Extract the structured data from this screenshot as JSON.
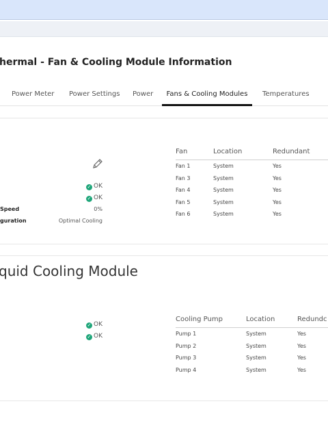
{
  "page_title": "hermal - Fan & Cooling Module Information",
  "tabs": [
    {
      "label": "Power Meter"
    },
    {
      "label": "Power Settings"
    },
    {
      "label": "Power"
    },
    {
      "label": "Fans & Cooling Modules",
      "active": true
    },
    {
      "label": "Temperatures"
    }
  ],
  "fans_summary": {
    "status1": "OK",
    "status2": "OK",
    "speed_label": "Speed",
    "speed_value": "0%",
    "config_label": "guration",
    "config_value": "Optimal Cooling"
  },
  "fan_table": {
    "headers": [
      "Fan",
      "Location",
      "Redundant"
    ],
    "rows": [
      [
        "Fan 1",
        "System",
        "Yes"
      ],
      [
        "Fan 3",
        "System",
        "Yes"
      ],
      [
        "Fan 4",
        "System",
        "Yes"
      ],
      [
        "Fan 5",
        "System",
        "Yes"
      ],
      [
        "Fan 6",
        "System",
        "Yes"
      ]
    ]
  },
  "liquid_section": {
    "title": "quid Cooling Module",
    "status1": "OK",
    "status2": "OK"
  },
  "pump_table": {
    "headers": [
      "Cooling Pump",
      "Location",
      "Redundc"
    ],
    "rows": [
      [
        "Pump 1",
        "System",
        "Yes"
      ],
      [
        "Pump 2",
        "System",
        "Yes"
      ],
      [
        "Pump 3",
        "System",
        "Yes"
      ],
      [
        "Pump 4",
        "System",
        "Yes"
      ]
    ]
  },
  "icons": {
    "edit": "pencil-icon",
    "ok": "check-circle-icon"
  },
  "colors": {
    "ok_green": "#1fa67a",
    "topbar": "#d9e6fb",
    "active_tab": "#111111"
  }
}
